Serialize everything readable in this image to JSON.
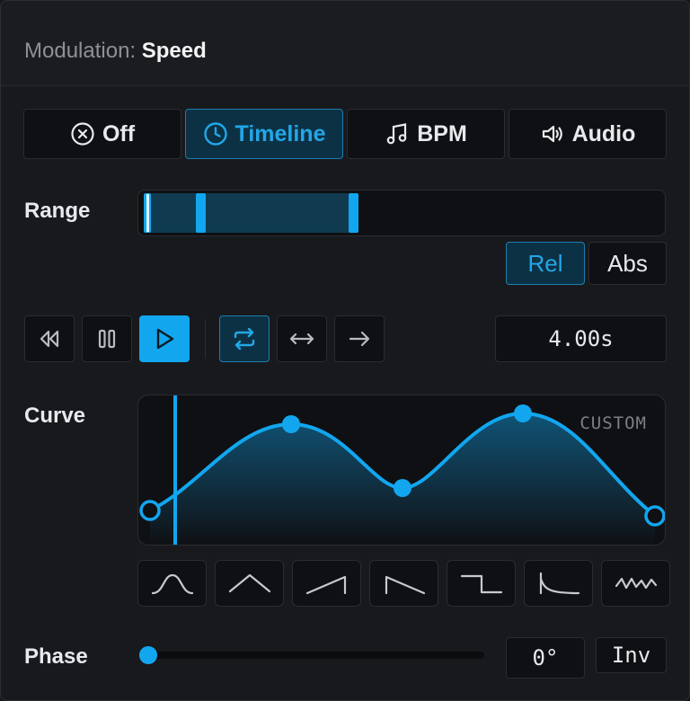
{
  "header": {
    "prefix": "Modulation:",
    "param": "Speed"
  },
  "modes": [
    {
      "label": "Off",
      "icon": "close-circle-icon",
      "active": false
    },
    {
      "label": "Timeline",
      "icon": "clock-icon",
      "active": true
    },
    {
      "label": "BPM",
      "icon": "music-note-icon",
      "active": false
    },
    {
      "label": "Audio",
      "icon": "speaker-icon",
      "active": false
    }
  ],
  "range": {
    "label": "Range",
    "rel_label": "Rel",
    "abs_label": "Abs",
    "mode": "Rel",
    "start_fraction": 0.11,
    "end_fraction": 0.4,
    "playhead_fraction": 0.01
  },
  "transport": {
    "buttons": [
      {
        "name": "rewind-button",
        "icon": "rewind-icon"
      },
      {
        "name": "pause-button",
        "icon": "pause-icon"
      },
      {
        "name": "play-button",
        "icon": "play-icon",
        "active": true
      },
      {
        "name": "loop-button",
        "icon": "loop-icon",
        "active": true
      },
      {
        "name": "pingpong-button",
        "icon": "bidirectional-arrow-icon"
      },
      {
        "name": "oneshot-button",
        "icon": "arrow-right-icon"
      }
    ],
    "duration": "4.00s"
  },
  "curve": {
    "label": "Curve",
    "tag": "CUSTOM",
    "accent": "#12a6ef"
  },
  "presets": [
    {
      "name": "preset-bell",
      "icon": "bell-curve-icon"
    },
    {
      "name": "preset-triangle",
      "icon": "triangle-icon"
    },
    {
      "name": "preset-ramp-up",
      "icon": "ramp-up-icon"
    },
    {
      "name": "preset-ramp-down",
      "icon": "ramp-down-icon"
    },
    {
      "name": "preset-step",
      "icon": "step-icon"
    },
    {
      "name": "preset-decay",
      "icon": "decay-icon"
    },
    {
      "name": "preset-noise",
      "icon": "noise-icon"
    }
  ],
  "phase": {
    "label": "Phase",
    "value": "0°",
    "fraction": 0.0,
    "inv_label": "Inv"
  }
}
